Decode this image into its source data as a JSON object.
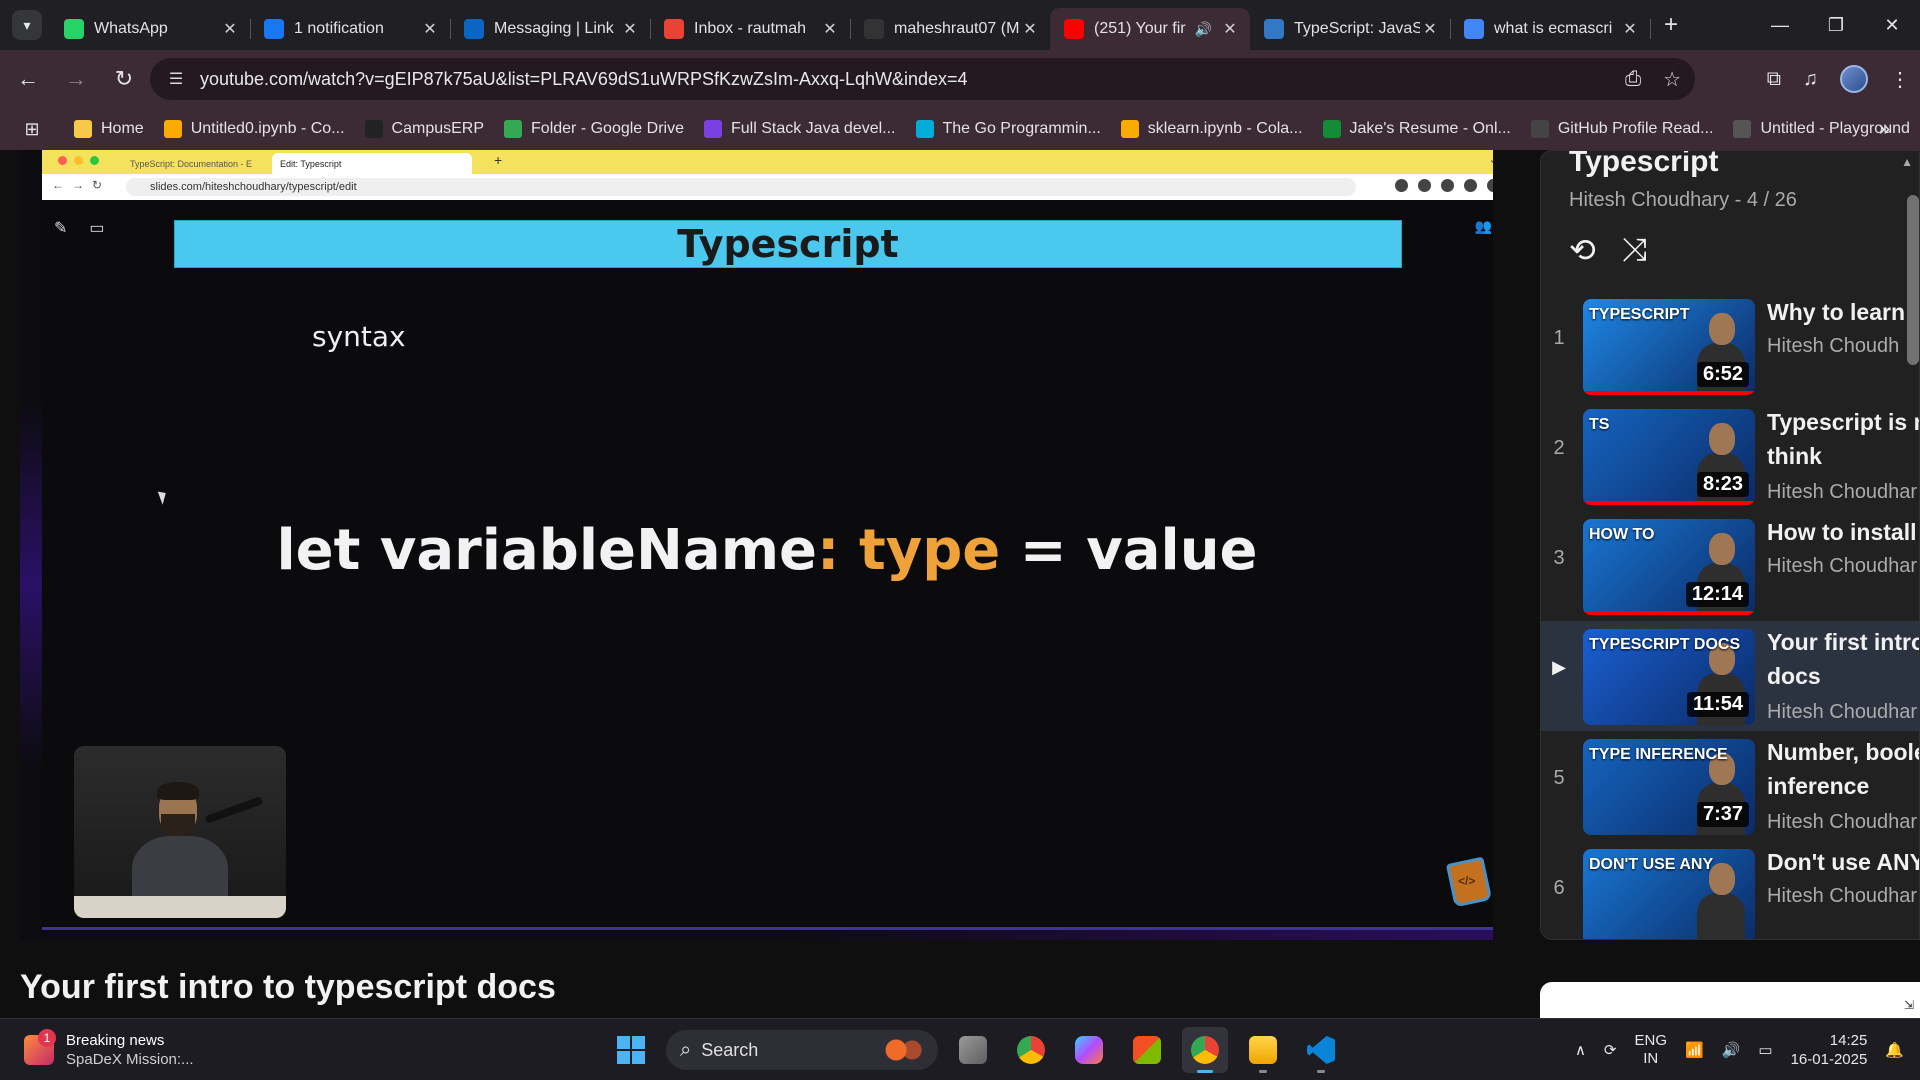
{
  "colors": {
    "accent_red": "#ff0000",
    "chrome_frame": "#3c2a34",
    "slide_banner": "#4ac8ee",
    "code_keyword": "#f0a23a"
  },
  "tabs": [
    {
      "title": "WhatsApp",
      "icon": "whatsapp-icon",
      "color": "#25d366"
    },
    {
      "title": "1 notification",
      "icon": "notification-icon",
      "color": "#1877f2"
    },
    {
      "title": "Messaging | Link",
      "icon": "linkedin-icon",
      "color": "#0a66c2"
    },
    {
      "title": "Inbox - rautmah",
      "icon": "gmail-icon",
      "color": "#ea4335"
    },
    {
      "title": "maheshraut07 (M",
      "icon": "github-icon",
      "color": "#333333"
    },
    {
      "title": "(251) Your fir",
      "icon": "youtube-icon",
      "color": "#ff0000"
    },
    {
      "title": "TypeScript: JavaS",
      "icon": "typescript-icon",
      "color": "#3178c6"
    },
    {
      "title": "what is ecmascri",
      "icon": "google-icon",
      "color": "#4285f4"
    }
  ],
  "address": {
    "url": "youtube.com/watch?v=gEIP87k75aU&list=PLRAV69dS1uWRPSfKzwZsIm-Axxq-LqhW&index=4"
  },
  "bookmarks": [
    {
      "label": "Home",
      "icon": "home-icon",
      "color": "#f7c948"
    },
    {
      "label": "Untitled0.ipynb - Co...",
      "icon": "colab-icon",
      "color": "#f9ab00"
    },
    {
      "label": "CampusERP",
      "icon": "campuserp-icon",
      "color": "#222222"
    },
    {
      "label": "Folder - Google Drive",
      "icon": "drive-icon",
      "color": "#34a853"
    },
    {
      "label": "Full Stack Java devel...",
      "icon": "course-icon",
      "color": "#7b3fe4"
    },
    {
      "label": "The Go Programmin...",
      "icon": "go-icon",
      "color": "#00add8"
    },
    {
      "label": "sklearn.ipynb - Cola...",
      "icon": "colab-icon",
      "color": "#f9ab00"
    },
    {
      "label": "Jake's Resume - Onl...",
      "icon": "overleaf-icon",
      "color": "#138a36"
    },
    {
      "label": "GitHub Profile Read...",
      "icon": "github-readme-icon",
      "color": "#444444"
    },
    {
      "label": "Untitled - Playground",
      "icon": "playground-icon",
      "color": "#555555"
    }
  ],
  "video": {
    "inner_tabs": [
      "TypeScript: Documentation - E",
      "Edit: Typescript"
    ],
    "inner_url": "slides.com/hiteshchoudhary/typescript/edit",
    "slide_title": "Typescript",
    "slide_subtitle": "syntax",
    "code": {
      "part1": "let variableName",
      "colon": ":",
      "keyword": "type",
      "part2": "= value"
    }
  },
  "playlist": {
    "title": "Typescript",
    "subtitle": "Hitesh Choudhary - 4 / 26",
    "items": [
      {
        "index": "1",
        "title": "Why to learn",
        "title2": "",
        "channel": "Hitesh Choudh",
        "duration": "6:52",
        "thumb_text": "TYPESCRIPT",
        "thumb_color": "#1e88e5"
      },
      {
        "index": "2",
        "title": "Typescript is n",
        "title2": "think",
        "channel": "Hitesh Choudhar",
        "duration": "8:23",
        "thumb_text": "TS",
        "thumb_color": "#1565c0"
      },
      {
        "index": "3",
        "title": "How to install",
        "title2": "",
        "channel": "Hitesh Choudhar",
        "duration": "12:14",
        "thumb_text": "HOW TO",
        "thumb_color": "#1976d2"
      },
      {
        "index": "▶",
        "title": "Your first intro",
        "title2": "docs",
        "channel": "Hitesh Choudhar",
        "duration": "11:54",
        "thumb_text": "TYPESCRIPT DOCS",
        "thumb_color": "#1a5fd1",
        "current": true
      },
      {
        "index": "5",
        "title": "Number, boole",
        "title2": "inference",
        "channel": "Hitesh Choudhar",
        "duration": "7:37",
        "thumb_text": "TYPE INFERENCE",
        "thumb_color": "#1565c0"
      },
      {
        "index": "6",
        "title": "Don't use ANY",
        "title2": "",
        "channel": "Hitesh Choudhar",
        "duration": "",
        "thumb_text": "DON'T USE ANY",
        "thumb_color": "#1976d2"
      }
    ]
  },
  "video_title": "Your first intro to typescript docs",
  "taskbar": {
    "news_badge": "1",
    "news_line1": "Breaking news",
    "news_line2": "SpaDeX Mission:...",
    "search_label": "Search",
    "lang1": "ENG",
    "lang2": "IN",
    "time": "14:25",
    "date": "16-01-2025"
  }
}
